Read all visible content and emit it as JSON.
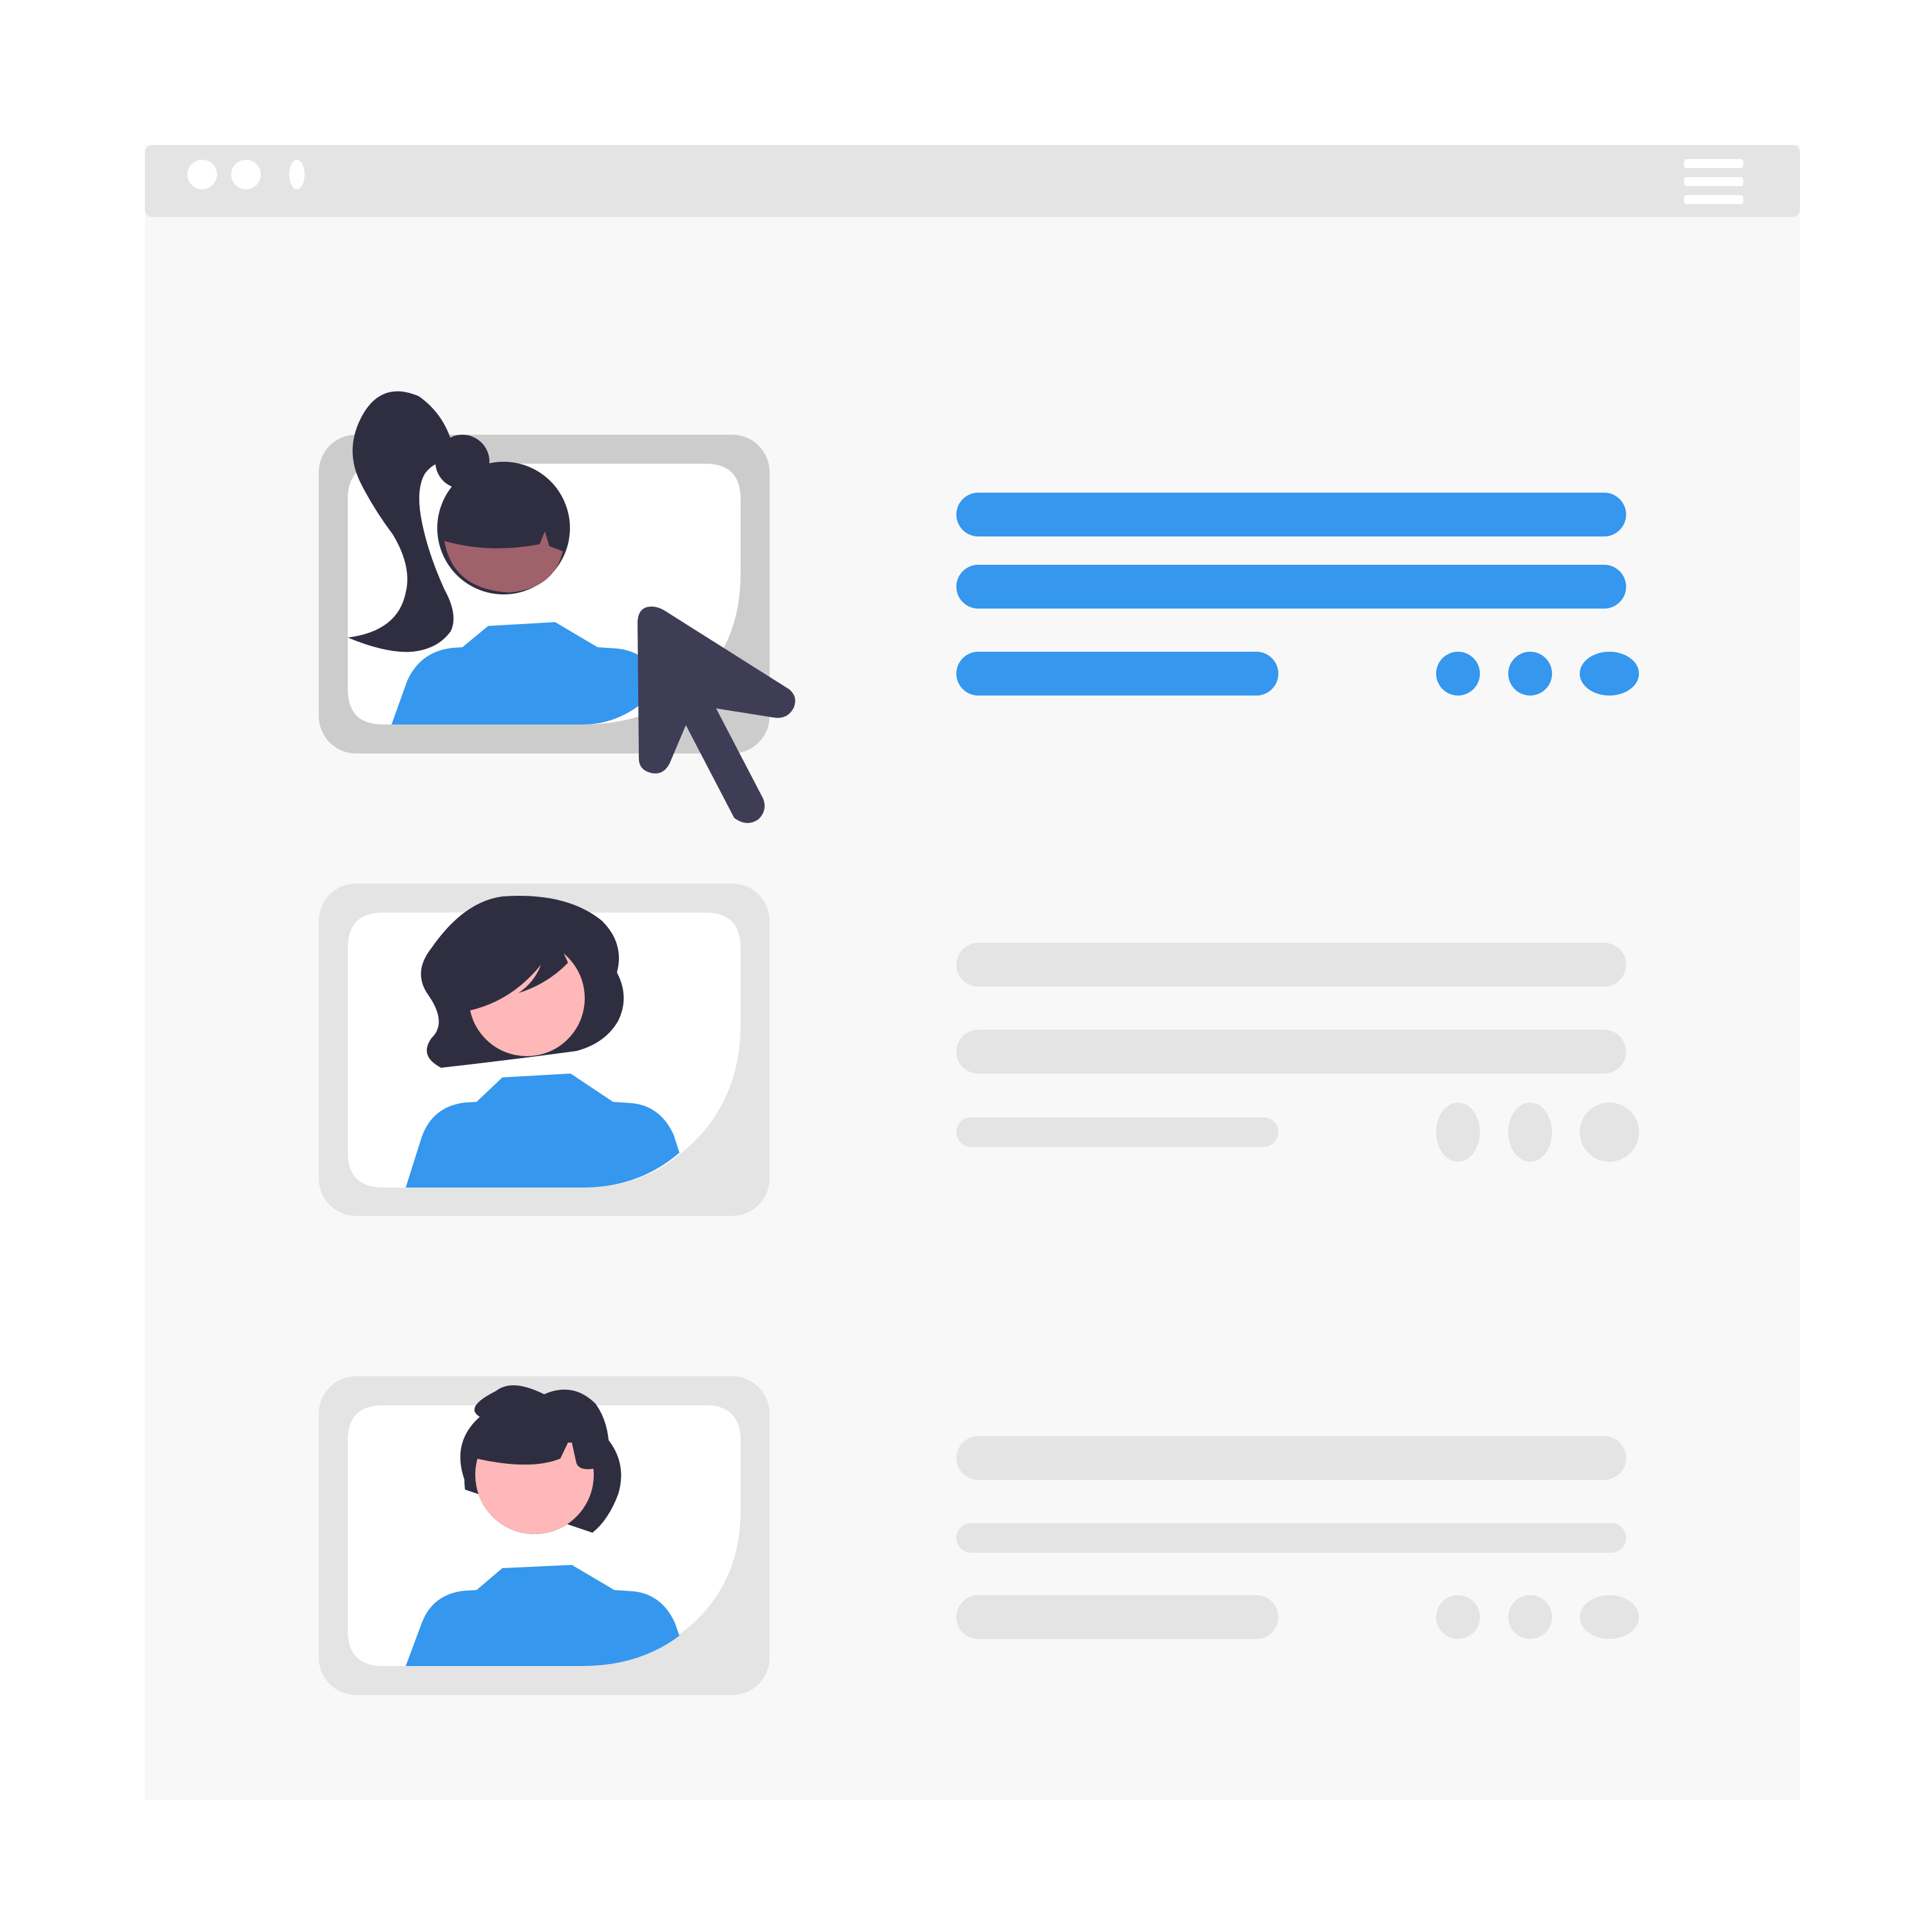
{
  "window": {
    "background": "#f8f8f8",
    "titlebar_color": "#e4e4e4",
    "controls": [
      "window-dot",
      "window-dot",
      "window-dot-narrow"
    ],
    "menu_icon": "hamburger-menu-icon"
  },
  "profiles": [
    {
      "name": "profile-card-1",
      "state": "selected",
      "hair": "ponytail",
      "skin": "#9f616a",
      "shirt": "#3597ee",
      "accent": "#3597ee"
    },
    {
      "name": "profile-card-2",
      "state": "inactive",
      "hair": "bob",
      "skin": "#ffb8b8",
      "shirt": "#3597ee",
      "accent": "#e4e4e4"
    },
    {
      "name": "profile-card-3",
      "state": "inactive",
      "hair": "short",
      "skin": "#ffb8b8",
      "shirt": "#3597ee",
      "accent": "#e4e4e4"
    }
  ],
  "cursor": {
    "icon": "mouse-pointer-icon",
    "color": "#3f3d56"
  },
  "colors": {
    "accent": "#3597ee",
    "placeholder": "#e4e4e4",
    "hair": "#2f2e41",
    "frame_selected": "#cccccc",
    "frame": "#e4e4e4"
  }
}
